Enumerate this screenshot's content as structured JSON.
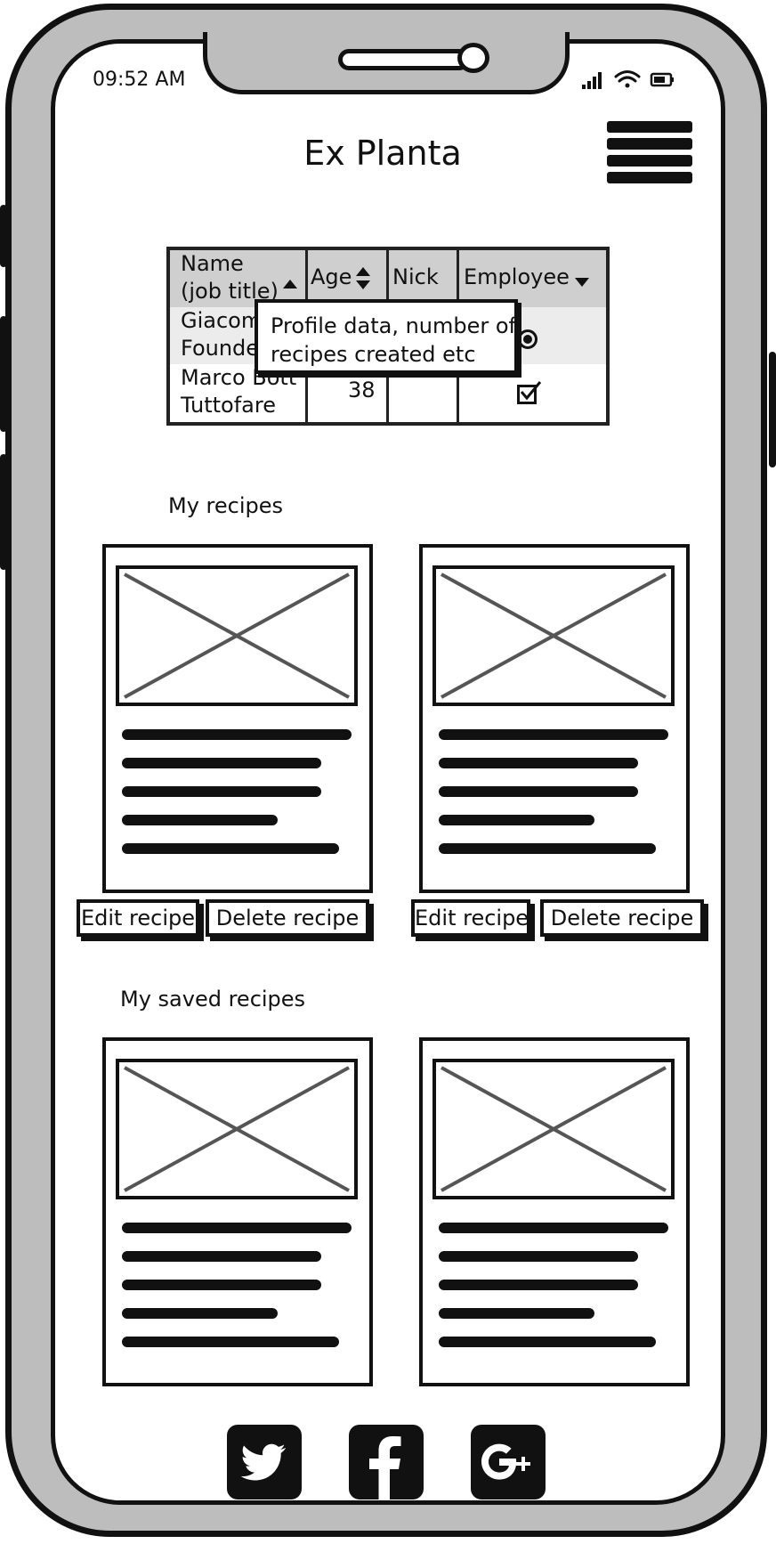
{
  "status_bar": {
    "time": "09:52 AM"
  },
  "header": {
    "title": "Ex Planta",
    "menu_icon": "hamburger-menu-icon"
  },
  "table": {
    "columns": [
      {
        "label_line1": "Name",
        "label_line2": "(job title)",
        "sort": "ascending"
      },
      {
        "label": "Age",
        "sort": "sortable"
      },
      {
        "label": "Nick"
      },
      {
        "label": "Employee",
        "sort": "dropdown"
      }
    ],
    "rows": [
      {
        "name": "Giacom",
        "job": "Founde",
        "age": "",
        "nick": "",
        "employee": "radio-selected"
      },
      {
        "name": "Marco Bott",
        "job": "Tuttofare",
        "age": "38",
        "nick": "",
        "employee": "checkbox-checked"
      }
    ],
    "tooltip": {
      "line1": "Profile data, number of",
      "line2": "recipes created etc"
    }
  },
  "my_recipes": {
    "title": "My recipes",
    "cards": [
      {
        "edit_label": "Edit recipe",
        "delete_label": "Delete recipe"
      },
      {
        "edit_label": "Edit recipe",
        "delete_label": "Delete recipe"
      }
    ]
  },
  "saved_recipes": {
    "title": "My saved recipes"
  },
  "footer": {
    "social": [
      "twitter-icon",
      "facebook-icon",
      "google-plus-icon"
    ]
  }
}
